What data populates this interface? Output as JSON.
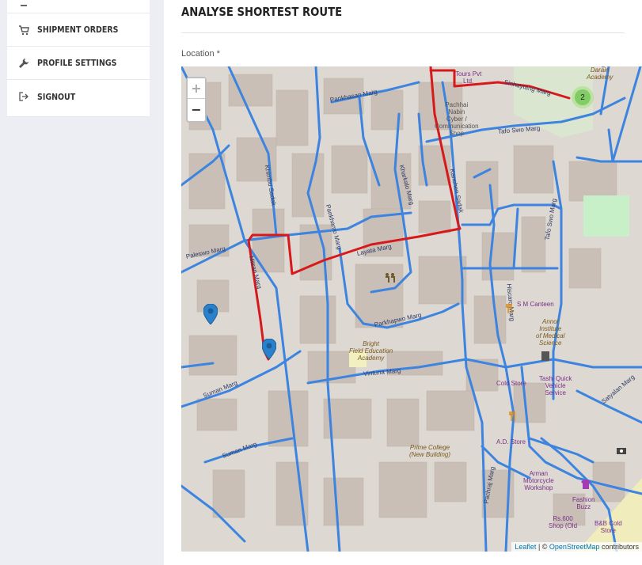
{
  "sidebar": {
    "items": [
      {
        "label": "",
        "icon": "partial-icon"
      },
      {
        "label": "SHIPMENT ORDERS",
        "icon": "cart-icon"
      },
      {
        "label": "PROFILE SETTINGS",
        "icon": "wrench-icon"
      },
      {
        "label": "SIGNOUT",
        "icon": "signout-icon"
      }
    ]
  },
  "main": {
    "title": "ANALYSE SHORTEST ROUTE",
    "location_label": "Location *"
  },
  "map": {
    "zoom_in": "+",
    "zoom_out": "−",
    "cluster_count": "2",
    "attribution_leaflet": "Leaflet",
    "attribution_sep": " | © ",
    "attribution_osm": "OpenStreetMap",
    "attribution_tail": " contributors",
    "route_color": "#d7191c",
    "road_color": "#3c84e0",
    "streets": {
      "sinhaytang": "Sinhaytang Marg",
      "pankhasan": "Pankhasan Marg",
      "tafo_swo_top": "Tafo Swo Marg",
      "paleswo": "Paleswo Marg",
      "layata": "Layata Marg",
      "khimbu": "Khimbu Sadak",
      "pankhamo": "Pankhamo Marg",
      "kharkalo": "Kharkalo Marg",
      "kanchen": "Kanchen Sadak",
      "parkhapwo": "Parkhapwo Marg",
      "mitran": "Mitran Marg",
      "tafo_swo_right": "Tafo Swo Marg",
      "hiscaro": "Hiscaro Marg",
      "vintuna": "Vintuna Marg",
      "suman1": "Suman Marg",
      "suman2": "Suman Marg",
      "pachraj": "Pachraj Marg",
      "satyalan": "Satyalan Marg"
    },
    "pois": {
      "tours": "Tours Pvt\nLtd.",
      "darain": "Darain\nAcademy",
      "pachhai": "Pachhai\nNabin\nCyber /\nCommunication\nShop",
      "sm_canteen": "S M Canteen",
      "annol": "Annol\nInstitute\nof Medical\nScience",
      "bright": "Bright\nField Education\nAcademy",
      "cold_store": "Cold Store",
      "tashi": "Tashi Quick\nVehicle\nService",
      "prime": "Prime College\n(New Building)",
      "ad_store": "A.D. Store",
      "arman": "Arman\nMotorcycle\nWorkshop",
      "fashion": "Fashion\nBuzz",
      "rs600": "Rs.600\nShop (Old",
      "bb": "B&B Cold\nStore"
    }
  }
}
